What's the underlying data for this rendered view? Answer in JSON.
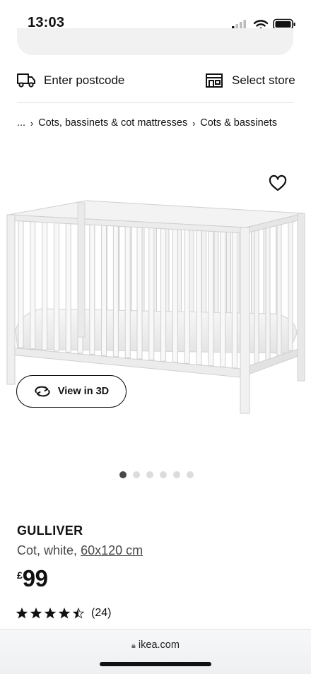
{
  "status_bar": {
    "time": "13:03",
    "icons": [
      "signal-icon",
      "wifi-icon",
      "battery-icon"
    ]
  },
  "delivery": {
    "postcode_label": "Enter postcode",
    "store_label": "Select store"
  },
  "breadcrumb": {
    "ellipsis": "...",
    "items": [
      "Cots, bassinets & cot mattresses",
      "Cots & bassinets"
    ]
  },
  "product": {
    "view_3d_label": "View in 3D",
    "carousel": {
      "total": 6,
      "active_index": 0
    },
    "name": "GULLIVER",
    "description": "Cot, white,",
    "size": "60x120 cm",
    "price_currency": "£",
    "price_value": "99",
    "rating_value": 4.5,
    "rating_max": 5,
    "rating_count": "(24)"
  },
  "browser": {
    "url": "ikea.com"
  },
  "colors": {
    "text": "#111111",
    "muted": "#484848",
    "dot_active": "#484848",
    "dot_inactive": "#dcdcdc"
  }
}
